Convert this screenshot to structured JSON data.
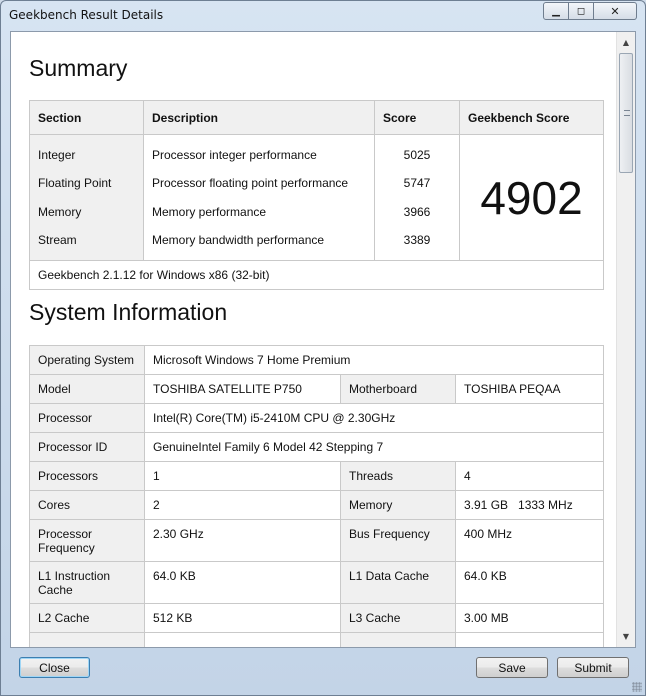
{
  "window": {
    "title": "Geekbench Result Details",
    "controls": {
      "minimize": "▁",
      "maximize": "◻",
      "close": "✕"
    }
  },
  "summary": {
    "heading": "Summary",
    "headers": {
      "section": "Section",
      "description": "Description",
      "score": "Score",
      "geekbench_score": "Geekbench Score"
    },
    "rows": [
      {
        "section": "Integer",
        "description": "Processor integer performance",
        "score": "5025"
      },
      {
        "section": "Floating Point",
        "description": "Processor floating point performance",
        "score": "5747"
      },
      {
        "section": "Memory",
        "description": "Memory performance",
        "score": "3966"
      },
      {
        "section": "Stream",
        "description": "Memory bandwidth performance",
        "score": "3389"
      }
    ],
    "total_score": "4902",
    "footer": "Geekbench 2.1.12 for Windows x86 (32-bit)"
  },
  "system_info": {
    "heading": "System Information",
    "os_label": "Operating System",
    "os_value": "Microsoft Windows 7 Home Premium",
    "model_label": "Model",
    "model_value": "TOSHIBA SATELLITE P750",
    "motherboard_label": "Motherboard",
    "motherboard_value": "TOSHIBA PEQAA",
    "processor_label": "Processor",
    "processor_value": "Intel(R) Core(TM) i5-2410M CPU @ 2.30GHz",
    "processor_id_label": "Processor ID",
    "processor_id_value": "GenuineIntel Family 6 Model 42 Stepping 7",
    "processors_label": "Processors",
    "processors_value": "1",
    "threads_label": "Threads",
    "threads_value": "4",
    "cores_label": "Cores",
    "cores_value": "2",
    "memory_label": "Memory",
    "memory_value": "3.91 GB   1333 MHz",
    "proc_freq_label": "Processor Frequency",
    "proc_freq_value": "2.30 GHz",
    "bus_freq_label": "Bus Frequency",
    "bus_freq_value": "400 MHz",
    "l1i_label": "L1 Instruction Cache",
    "l1i_value": "64.0 KB",
    "l1d_label": "L1 Data Cache",
    "l1d_value": "64.0 KB",
    "l2_label": "L2 Cache",
    "l2_value": "512 KB",
    "l3_label": "L3 Cache",
    "l3_value": "3.00 MB"
  },
  "buttons": {
    "close": "Close",
    "save": "Save",
    "submit": "Submit"
  },
  "scrollbar": {
    "up_icon": "▲",
    "down_icon": "▼"
  }
}
